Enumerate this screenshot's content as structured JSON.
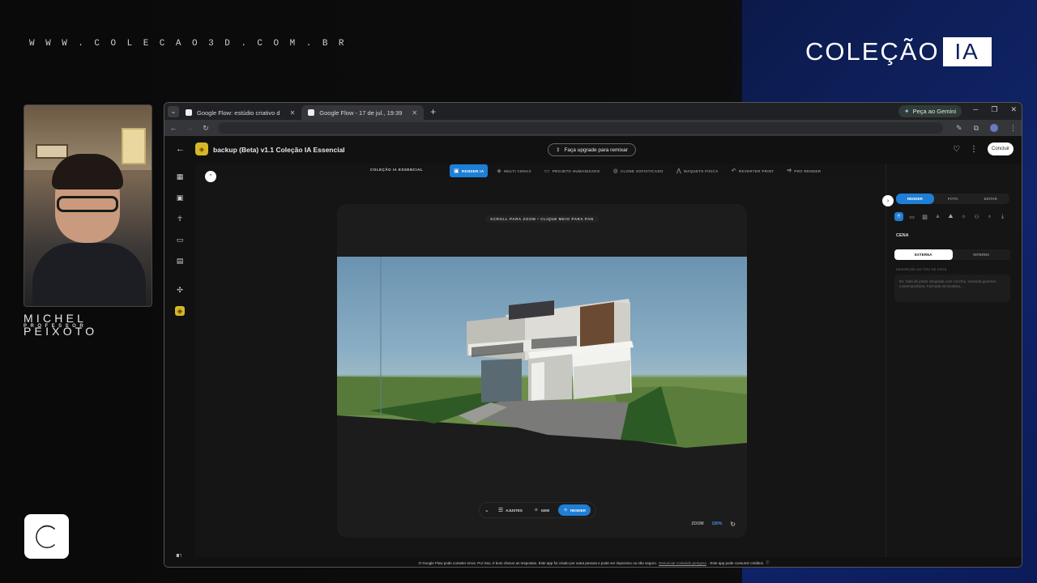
{
  "overlay": {
    "site_url": "WWW.COLECAO3D.COM.BR",
    "brand_text": "COLEÇÃO",
    "brand_box": "IA",
    "presenter_name": "MICHEL PEIXOTO",
    "presenter_role": "PROFESSOR"
  },
  "browser": {
    "tabs": [
      {
        "title": "Google Flow: estúdio criativo d",
        "active": false
      },
      {
        "title": "Google Flow - 17 de jul., 19:39",
        "active": true
      }
    ],
    "gemini_label": "Peça ao Gemini",
    "url": ""
  },
  "app": {
    "project_title": "backup (Beta) v1.1 Coleção IA Essencial",
    "upgrade_label": "Faça upgrade para remixar",
    "finish_label": "Concluir",
    "toolbar": {
      "brand": "COLEÇÃO IA ESSENCIAL",
      "tabs": [
        {
          "label": "RENDER IA",
          "icon": "render-icon",
          "active": true
        },
        {
          "label": "MULTI CENAS",
          "icon": "layers-icon",
          "active": false
        },
        {
          "label": "PROJETO HUMANIZADO",
          "icon": "plan-icon",
          "active": false
        },
        {
          "label": "CLONE SOFISTICADO",
          "icon": "clone-icon",
          "active": false
        },
        {
          "label": "MAQUETE FÍSICA",
          "icon": "model-icon",
          "active": false
        },
        {
          "label": "REVERTER PRINT",
          "icon": "revert-icon",
          "active": false
        },
        {
          "label": "PRO RENDER",
          "icon": "pro-icon",
          "active": false
        }
      ]
    },
    "canvas": {
      "hint": "SCROLL PARA ZOOM • CLIQUE MEIO PARA PAN",
      "zoom_label": "ZOOM",
      "zoom_value": "100%"
    },
    "bottombar": {
      "adjust_label": "AJUSTES",
      "gem_label": "GEM",
      "render_label": "RENDER"
    },
    "rightpanel": {
      "tabs": [
        {
          "label": "RENDER",
          "active": true
        },
        {
          "label": "FOTO",
          "active": false
        },
        {
          "label": "EDITAR",
          "active": false
        }
      ],
      "section_title": "CENA",
      "scene_options": [
        {
          "label": "EXTERNA",
          "active": true
        },
        {
          "label": "INTERNA",
          "active": false
        }
      ],
      "field_label": "DESCRIÇÃO DO TIPO DE VISTA",
      "field_placeholder": "Ex: Sala de jantar integrada com cozinha, Varanda gourmet contemporânea, Fachada minimalista..."
    },
    "statusbar": {
      "text_before": "O Google Flow pode cometer erros. Por isso, é bom checar as respostas. Este app foi criado por outra pessoa e pode ser impreciso ou não seguro.",
      "link_text": "Denunciar conteúdo perigoso",
      "text_after": ". Este app pode consumir créditos"
    }
  },
  "colors": {
    "accent_blue": "#1e7fd6",
    "project_yellow": "#d7b728",
    "brand_navy": "#10246a"
  }
}
